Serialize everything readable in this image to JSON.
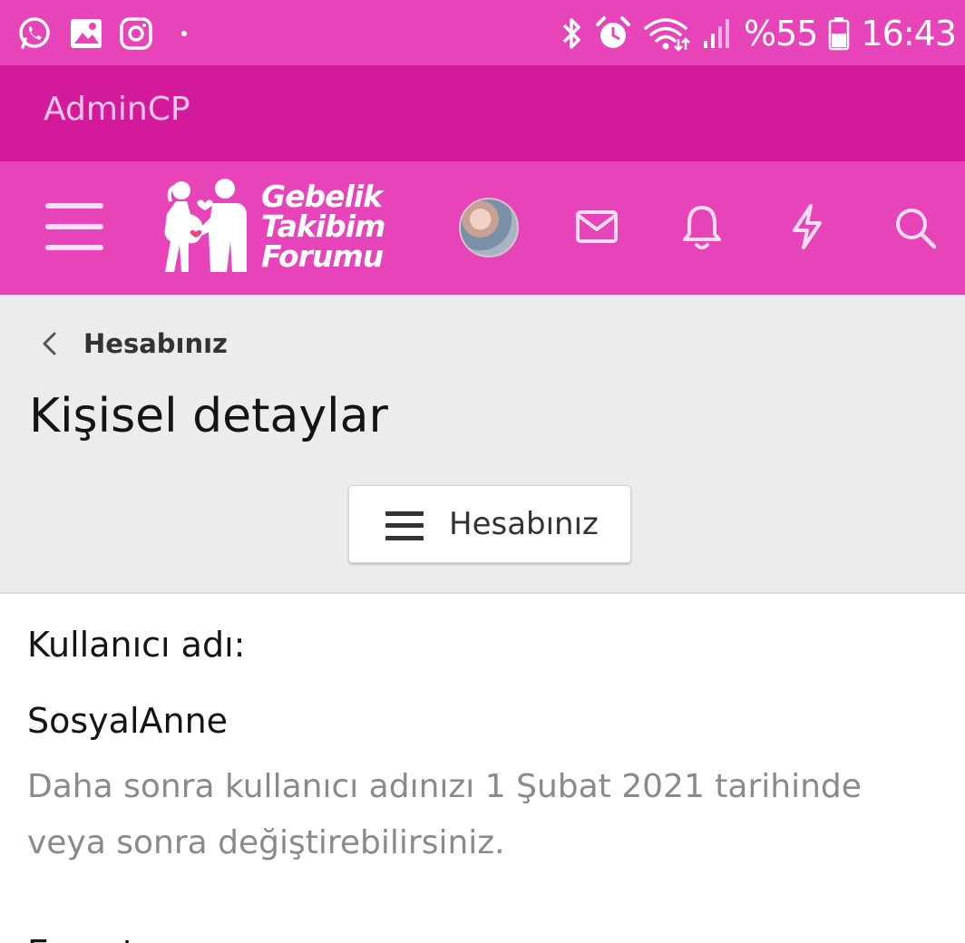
{
  "status_bar": {
    "battery": "%55",
    "time": "16:43",
    "icons": [
      "whatsapp-icon",
      "gallery-icon",
      "instagram-icon",
      "bluetooth-icon",
      "alarm-icon",
      "wifi-icon",
      "signal-icon",
      "battery-icon"
    ]
  },
  "admin_bar": {
    "link": "AdminCP"
  },
  "header": {
    "logo_lines": [
      "Gebelik",
      "Takibim",
      "Forumu"
    ],
    "icons": [
      "menu-icon",
      "avatar",
      "mail-icon",
      "bell-icon",
      "lightning-icon",
      "search-icon"
    ]
  },
  "breadcrumb": {
    "label": "Hesabınız"
  },
  "page": {
    "title": "Kişisel detaylar",
    "account_button": "Hesabınız"
  },
  "form": {
    "username_label": "Kullanıcı adı:",
    "username_value": "SosyalAnne",
    "username_hint": "Daha sonra kullanıcı adınızı 1 Şubat 2021 tarihinde veya sonra değiştirebilirsiniz.",
    "next_label": "E-posta:"
  },
  "colors": {
    "status_bar": "#e844b9",
    "admin_bar": "#d21a9b",
    "header": "#e844b9",
    "page_head": "#ececec"
  }
}
